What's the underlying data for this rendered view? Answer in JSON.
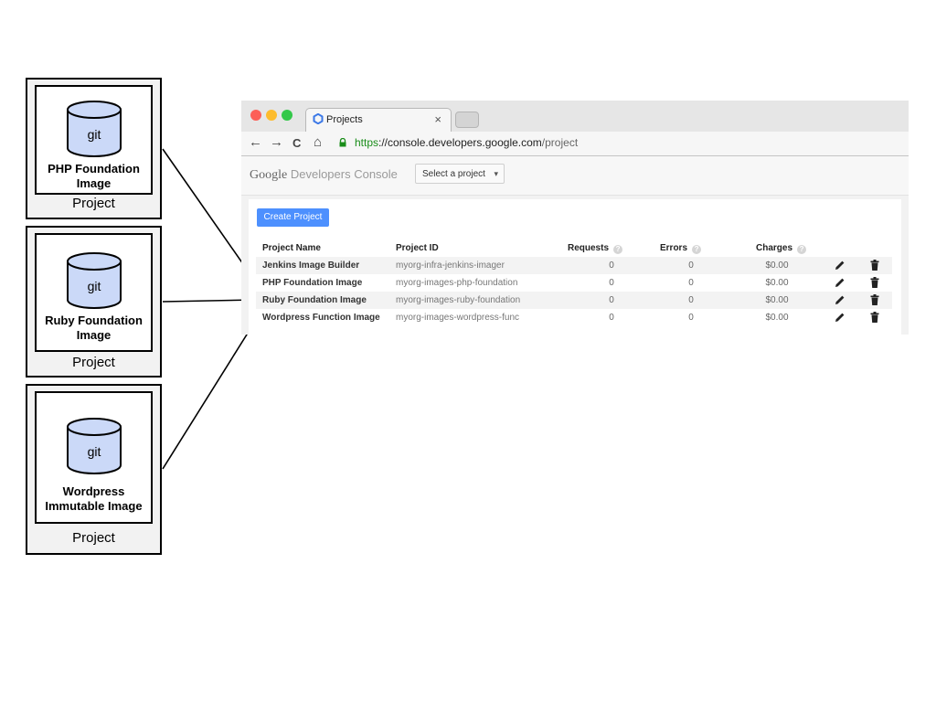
{
  "diagram": {
    "projects": [
      {
        "repo_icon_label": "git",
        "repo_name": "PHP Foundation Image",
        "project_label": "Project"
      },
      {
        "repo_icon_label": "git",
        "repo_name": "Ruby Foundation Image",
        "project_label": "Project"
      },
      {
        "repo_icon_label": "git",
        "repo_name": "Wordpress Immutable Image",
        "project_label": "Project"
      }
    ]
  },
  "browser": {
    "tab_title": "Projects",
    "tab_close": "×",
    "url_scheme": "https",
    "url_host": "://console.developers.google.com",
    "url_path": "/project",
    "nav": {
      "back": "←",
      "forward": "→",
      "reload": "C",
      "home": "⌂"
    }
  },
  "console": {
    "brand_google": "Google",
    "brand_product": "Developers Console",
    "select_project": "Select a project",
    "select_caret": "▾",
    "create_button": "Create Project",
    "columns": {
      "name": "Project Name",
      "id": "Project ID",
      "requests": "Requests",
      "errors": "Errors",
      "charges": "Charges",
      "help_glyph": "?"
    },
    "rows": [
      {
        "name": "Jenkins Image Builder",
        "id": "myorg-infra-jenkins-imager",
        "requests": "0",
        "errors": "0",
        "charges": "$0.00"
      },
      {
        "name": "PHP Foundation Image",
        "id": "myorg-images-php-foundation",
        "requests": "0",
        "errors": "0",
        "charges": "$0.00"
      },
      {
        "name": "Ruby Foundation Image",
        "id": "myorg-images-ruby-foundation",
        "requests": "0",
        "errors": "0",
        "charges": "$0.00"
      },
      {
        "name": "Wordpress Function Image",
        "id": "myorg-images-wordpress-func",
        "requests": "0",
        "errors": "0",
        "charges": "$0.00"
      }
    ]
  },
  "colors": {
    "cylinder_fill": "#cbd9f8",
    "primary_button": "#4d90fe",
    "https_green": "#1a8d1a"
  },
  "icons": [
    "database-icon",
    "google-cloud-icon",
    "lock-icon",
    "edit-icon",
    "trash-icon",
    "help-icon"
  ]
}
